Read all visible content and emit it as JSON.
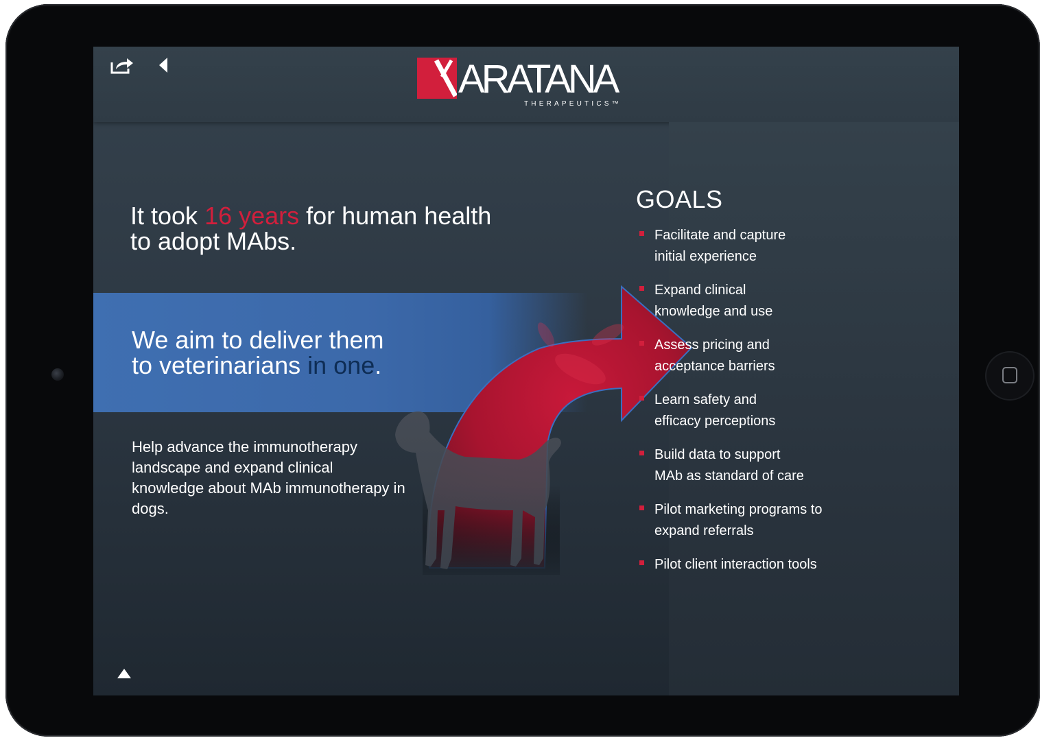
{
  "device": {
    "home_button_icon": "square-home-icon"
  },
  "toolbar": {
    "share_icon": "share-icon",
    "back_icon": "back-arrow-icon"
  },
  "logo": {
    "wordmark": "ARATANA",
    "subtitle": "THERAPEUTICS™"
  },
  "headline": {
    "prefix": "It took ",
    "highlight": "16 years",
    "suffix": " for human health to adopt MAbs."
  },
  "band": {
    "line1": "We aim to deliver them",
    "line2_prefix": "to veterinarians ",
    "emphasis": "in one",
    "line2_suffix": "."
  },
  "body_text": "Help advance the immunotherapy landscape and expand clinical knowledge about MAb immunotherapy in dogs.",
  "goals": {
    "title": "GOALS",
    "items": [
      "Facilitate and capture\ninitial experience",
      "Expand clinical\nknowledge and use",
      "Assess pricing and\nacceptance barriers",
      "Learn safety and\nefficacy perceptions",
      "Build data to support\nMAb as standard of care",
      "Pilot marketing programs to\nexpand referrals",
      "Pilot client interaction tools"
    ]
  },
  "footer": {
    "scroll_up_icon": "up-triangle-icon"
  },
  "colors": {
    "accent_red": "#d21f3c",
    "band_blue": "#3f6fb1",
    "screen_bg": "#2d3843"
  }
}
